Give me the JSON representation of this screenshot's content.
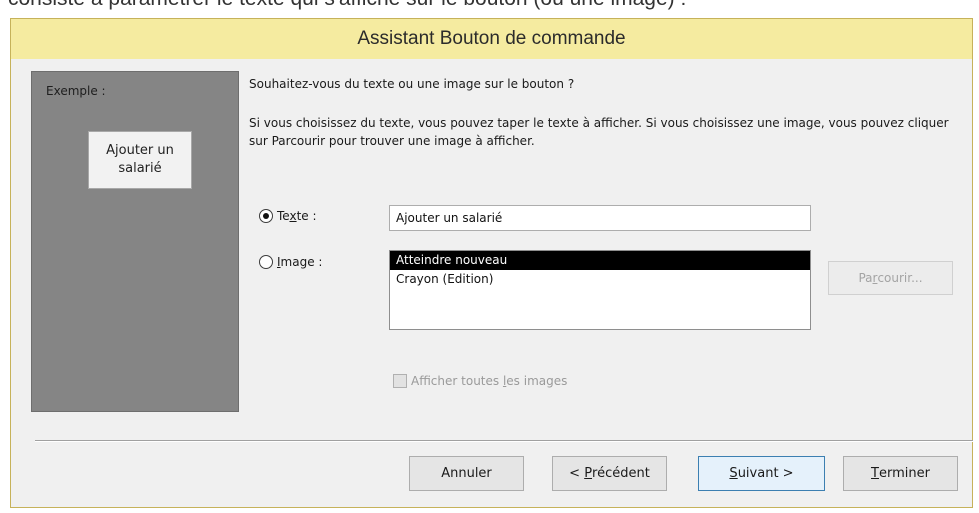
{
  "background_caption": "consiste à paramétrer le texte qui s'affiche sur le bouton (ou une image) :",
  "window": {
    "title": "Assistant Bouton de commande"
  },
  "sample": {
    "label": "Exemple :",
    "button_text": "Ajouter un salarié"
  },
  "content": {
    "question": "Souhaitez-vous du texte ou une image sur le bouton ?",
    "explanation": "Si vous choisissez du texte, vous pouvez taper le texte à afficher. Si vous choisissez une image, vous pouvez cliquer sur Parcourir pour trouver une image à afficher."
  },
  "options": {
    "text": {
      "label_before": "Te",
      "label_mnemonic": "x",
      "label_after": "te :",
      "selected": true,
      "value": "Ajouter un salarié"
    },
    "image": {
      "label_mnemonic": "I",
      "label_after": "mage :",
      "selected": false,
      "items": [
        {
          "label": "Atteindre nouveau",
          "selected": true
        },
        {
          "label": "Crayon (Edition)",
          "selected": false
        }
      ]
    }
  },
  "browse_button": {
    "before": "Pa",
    "mnemonic": "r",
    "after": "courir..."
  },
  "show_all": {
    "before": "Afficher toutes ",
    "mnemonic": "l",
    "after": "es images",
    "checked": false
  },
  "buttons": {
    "cancel": "Annuler",
    "previous_prefix": "< ",
    "previous_mnemonic": "P",
    "previous_rest": "récédent",
    "next_mnemonic": "S",
    "next_rest": "uivant >",
    "finish_mnemonic": "T",
    "finish_rest": "erminer"
  },
  "colors": {
    "title_bar": "#f5eba0",
    "sample_panel": "#858585",
    "selection": "#000000"
  }
}
